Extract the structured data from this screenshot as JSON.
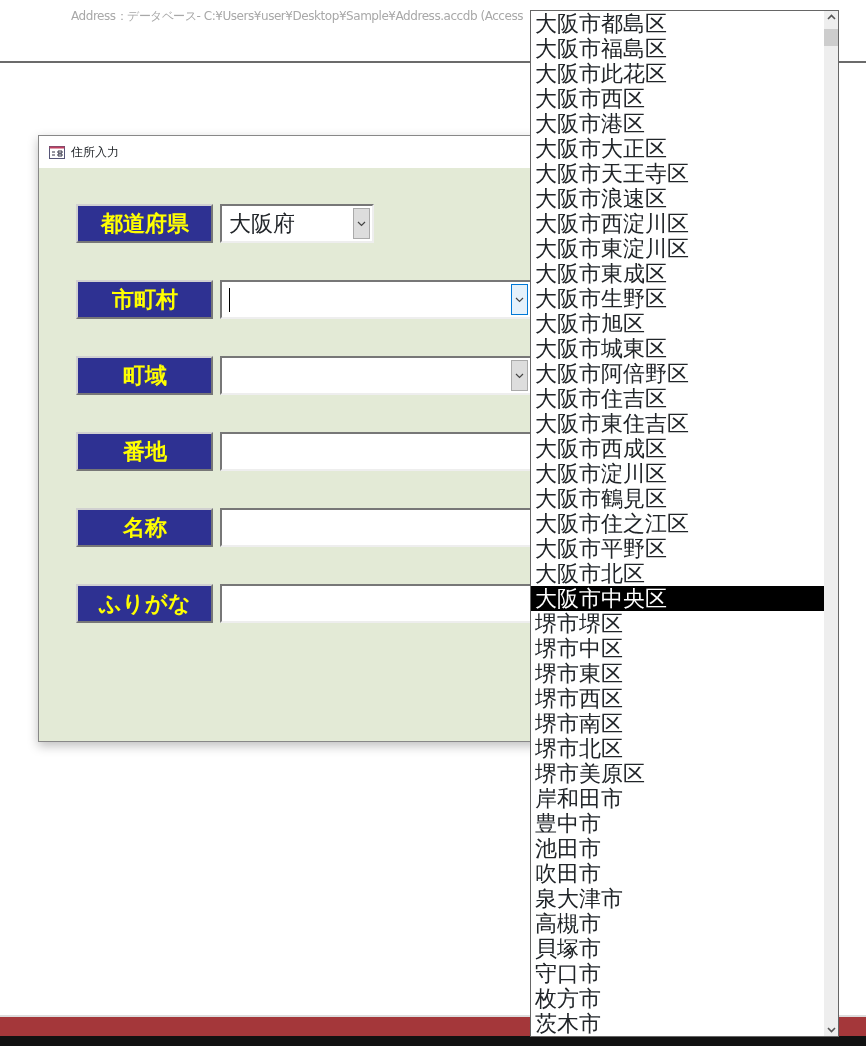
{
  "app_title": "Address：データベース- C:¥Users¥user¥Desktop¥Sample¥Address.accdb (Access",
  "form": {
    "title": "住所入力",
    "fields": [
      {
        "label": "都道府県",
        "kind": "combo",
        "value": "大阪府",
        "focused": false,
        "wide": false
      },
      {
        "label": "市町村",
        "kind": "combo",
        "focused": true,
        "wide": true
      },
      {
        "label": "町域",
        "kind": "combo",
        "focused": false,
        "wide": true
      },
      {
        "label": "番地",
        "kind": "text",
        "focused": false,
        "wide": true
      },
      {
        "label": "名称",
        "kind": "text",
        "focused": false,
        "wide": true
      },
      {
        "label": "ふりがな",
        "kind": "text",
        "focused": false,
        "wide": true
      }
    ]
  },
  "dropdown": {
    "items": [
      {
        "text": "大阪市都島区",
        "selected": false
      },
      {
        "text": "大阪市福島区",
        "selected": false
      },
      {
        "text": "大阪市此花区",
        "selected": false
      },
      {
        "text": "大阪市西区",
        "selected": false
      },
      {
        "text": "大阪市港区",
        "selected": false
      },
      {
        "text": "大阪市大正区",
        "selected": false
      },
      {
        "text": "大阪市天王寺区",
        "selected": false
      },
      {
        "text": "大阪市浪速区",
        "selected": false
      },
      {
        "text": "大阪市西淀川区",
        "selected": false
      },
      {
        "text": "大阪市東淀川区",
        "selected": false
      },
      {
        "text": "大阪市東成区",
        "selected": false
      },
      {
        "text": "大阪市生野区",
        "selected": false
      },
      {
        "text": "大阪市旭区",
        "selected": false
      },
      {
        "text": "大阪市城東区",
        "selected": false
      },
      {
        "text": "大阪市阿倍野区",
        "selected": false
      },
      {
        "text": "大阪市住吉区",
        "selected": false
      },
      {
        "text": "大阪市東住吉区",
        "selected": false
      },
      {
        "text": "大阪市西成区",
        "selected": false
      },
      {
        "text": "大阪市淀川区",
        "selected": false
      },
      {
        "text": "大阪市鶴見区",
        "selected": false
      },
      {
        "text": "大阪市住之江区",
        "selected": false
      },
      {
        "text": "大阪市平野区",
        "selected": false
      },
      {
        "text": "大阪市北区",
        "selected": false
      },
      {
        "text": "大阪市中央区",
        "selected": true
      },
      {
        "text": "堺市堺区",
        "selected": false
      },
      {
        "text": "堺市中区",
        "selected": false
      },
      {
        "text": "堺市東区",
        "selected": false
      },
      {
        "text": "堺市西区",
        "selected": false
      },
      {
        "text": "堺市南区",
        "selected": false
      },
      {
        "text": "堺市北区",
        "selected": false
      },
      {
        "text": "堺市美原区",
        "selected": false
      },
      {
        "text": "岸和田市",
        "selected": false
      },
      {
        "text": "豊中市",
        "selected": false
      },
      {
        "text": "池田市",
        "selected": false
      },
      {
        "text": "吹田市",
        "selected": false
      },
      {
        "text": "泉大津市",
        "selected": false
      },
      {
        "text": "高槻市",
        "selected": false
      },
      {
        "text": "貝塚市",
        "selected": false
      },
      {
        "text": "守口市",
        "selected": false
      },
      {
        "text": "枚方市",
        "selected": false
      },
      {
        "text": "茨木市",
        "selected": false
      }
    ]
  }
}
